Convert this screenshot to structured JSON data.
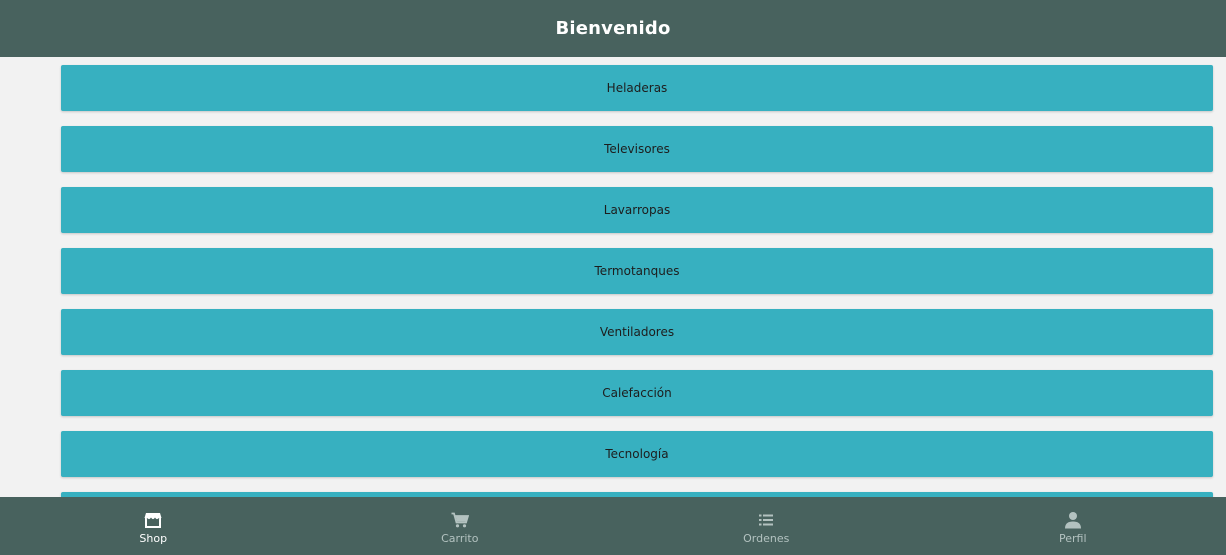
{
  "header": {
    "title": "Bienvenido"
  },
  "categories": [
    {
      "label": "Heladeras"
    },
    {
      "label": "Televisores"
    },
    {
      "label": "Lavarropas"
    },
    {
      "label": "Termotanques"
    },
    {
      "label": "Ventiladores"
    },
    {
      "label": "Calefacción"
    },
    {
      "label": "Tecnología"
    },
    {
      "label": ""
    }
  ],
  "bottom_nav": {
    "items": [
      {
        "label": "Shop",
        "icon": "store-icon",
        "active": true
      },
      {
        "label": "Carrito",
        "icon": "cart-icon",
        "active": false
      },
      {
        "label": "Ordenes",
        "icon": "list-icon",
        "active": false
      },
      {
        "label": "Perfil",
        "icon": "person-icon",
        "active": false
      }
    ]
  },
  "colors": {
    "header_bg": "#48625e",
    "button_bg": "#37b0c0",
    "page_bg": "#f2f2f2",
    "nav_active": "#ffffff",
    "nav_inactive": "#b3c2c0"
  }
}
